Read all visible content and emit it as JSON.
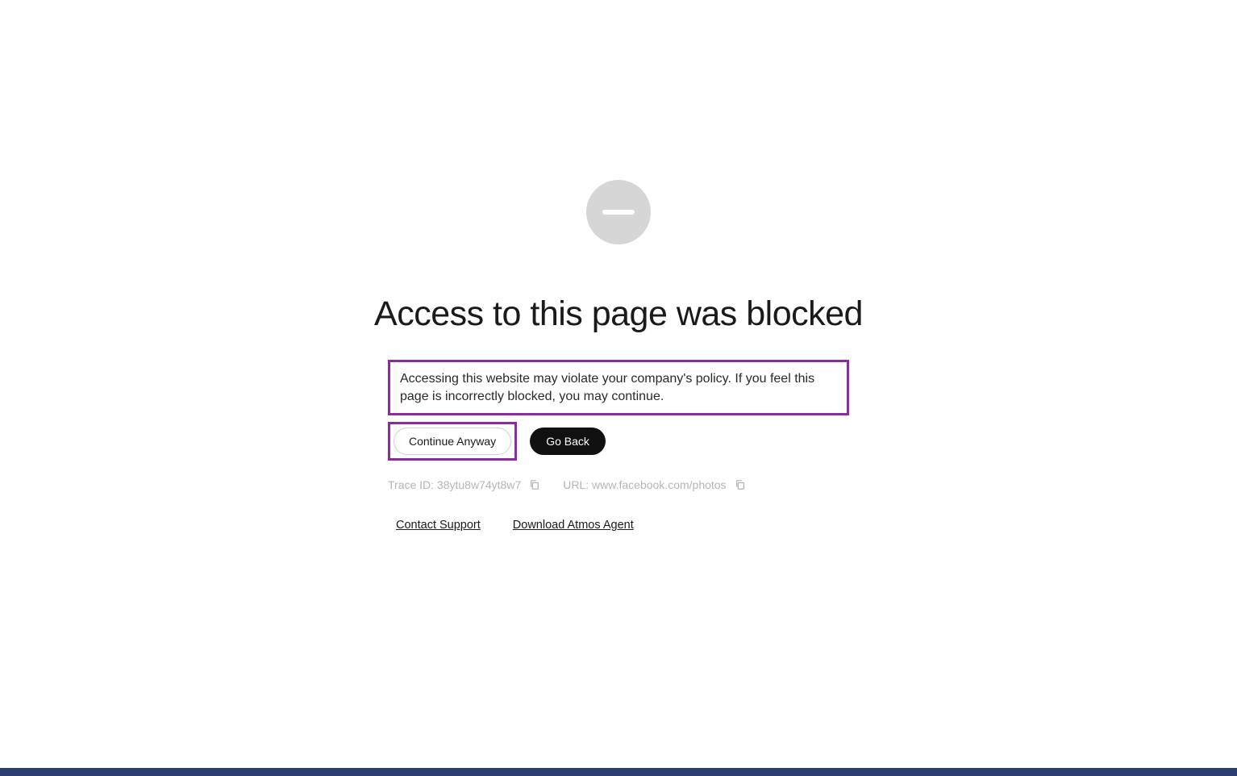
{
  "icon": "blocked-icon",
  "title": "Access to this page was blocked",
  "description": "Accessing this website may violate your company's policy. If you feel this page is incorrectly blocked, you may continue.",
  "buttons": {
    "continue": "Continue Anyway",
    "goback": "Go Back"
  },
  "meta": {
    "trace_label": "Trace ID:",
    "trace_id": "38ytu8w74yt8w7",
    "url_label": "URL:",
    "url": "www.facebook.com/photos"
  },
  "links": {
    "contact": "Contact Support",
    "download": "Download Atmos Agent"
  },
  "highlight_color": "#8a2b9f"
}
